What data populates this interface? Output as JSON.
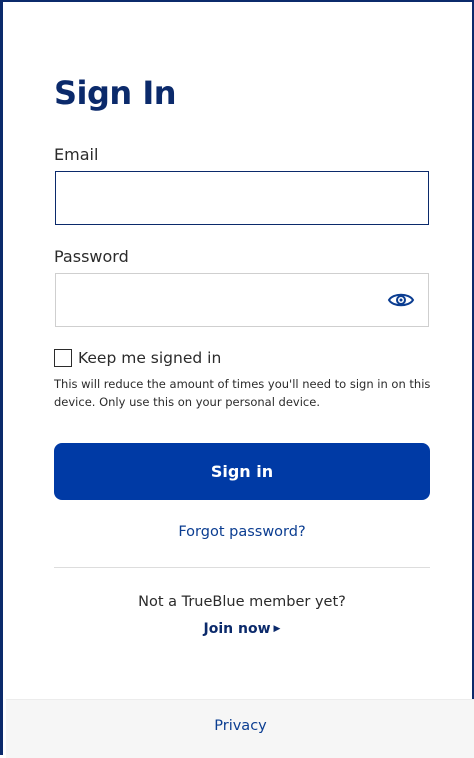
{
  "page": {
    "title": "Sign In"
  },
  "form": {
    "email_label": "Email",
    "email_value": "",
    "email_placeholder": "",
    "password_label": "Password",
    "password_value": "",
    "password_placeholder": "",
    "password_toggle_icon": "eye-icon",
    "keep_signed_in_label": "Keep me signed in",
    "keep_signed_in_checked": false,
    "keep_signed_in_help": "This will reduce the amount of times you'll need to sign in on this device. Only use this on your personal device.",
    "submit_label": "Sign in",
    "forgot_label": "Forgot password?"
  },
  "signup": {
    "prompt": "Not a TrueBlue member yet?",
    "join_label": "Join now",
    "join_icon": "caret-right-icon"
  },
  "footer": {
    "privacy_label": "Privacy"
  },
  "colors": {
    "brand_navy": "#0b2a6b",
    "button_blue": "#003aa5",
    "link_blue": "#0b3d91"
  }
}
